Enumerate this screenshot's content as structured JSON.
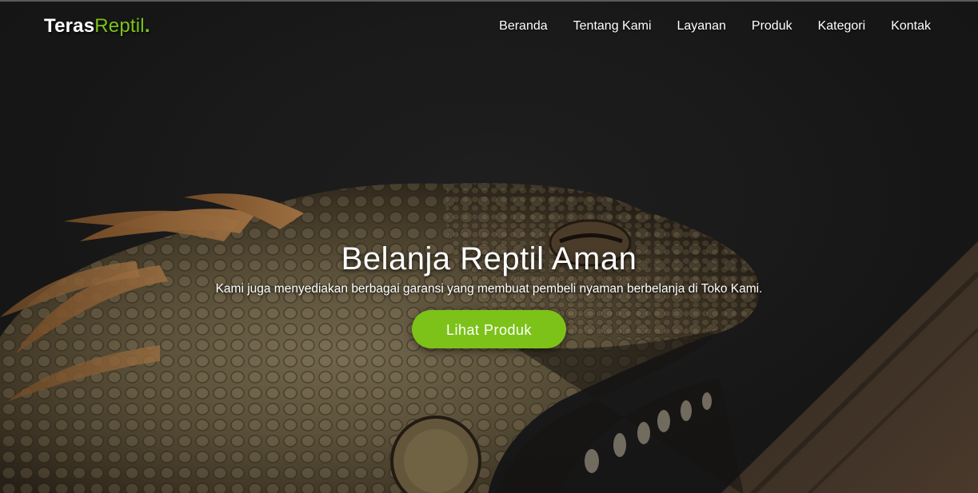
{
  "brand": {
    "part1": "Teras",
    "part2": "Reptil",
    "dot": ".",
    "accent_color": "#7cc219"
  },
  "nav": {
    "items": [
      {
        "label": "Beranda"
      },
      {
        "label": "Tentang Kami"
      },
      {
        "label": "Layanan"
      },
      {
        "label": "Produk"
      },
      {
        "label": "Kategori"
      },
      {
        "label": "Kontak"
      }
    ]
  },
  "hero": {
    "title": "Belanja Reptil Aman",
    "subtitle": "Kami juga menyediakan berbagai garansi yang membuat pembeli nyaman berbelanja di Toko Kami.",
    "cta_label": "Lihat Produk",
    "image_subject": "iguana-photo"
  }
}
